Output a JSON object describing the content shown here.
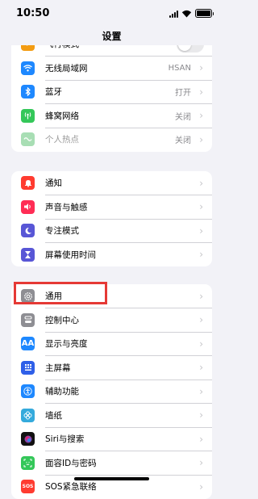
{
  "status": {
    "time": "10:50"
  },
  "nav": {
    "title": "设置"
  },
  "group1": {
    "items": [
      {
        "label": "飞行模式",
        "value": "",
        "icon": "airplane-icon",
        "color": "#F39C12"
      },
      {
        "label": "无线局域网",
        "value": "HSAN",
        "icon": "wifi-icon",
        "color": "#1E88FF"
      },
      {
        "label": "蓝牙",
        "value": "打开",
        "icon": "bluetooth-icon",
        "color": "#1E88FF"
      },
      {
        "label": "蜂窝网络",
        "value": "关闭",
        "icon": "cellular-icon",
        "color": "#34C759"
      },
      {
        "label": "个人热点",
        "value": "关闭",
        "icon": "hotspot-icon",
        "color": "#A8DEB4"
      }
    ]
  },
  "group2": {
    "items": [
      {
        "label": "通知",
        "icon": "notification-icon",
        "color": "#FF3B30"
      },
      {
        "label": "声音与触感",
        "icon": "sound-icon",
        "color": "#FF2D55"
      },
      {
        "label": "专注模式",
        "icon": "moon-icon",
        "color": "#5856D6"
      },
      {
        "label": "屏幕使用时间",
        "icon": "hourglass-icon",
        "color": "#5856D6"
      }
    ]
  },
  "group3": {
    "items": [
      {
        "label": "通用",
        "icon": "gear-icon",
        "color": "#8E8E93"
      },
      {
        "label": "控制中心",
        "icon": "control-center-icon",
        "color": "#8E8E93"
      },
      {
        "label": "显示与亮度",
        "icon": "display-icon",
        "color": "#1E88FF",
        "glyph": "AA"
      },
      {
        "label": "主屏幕",
        "icon": "home-screen-icon",
        "color": "#2F5FE8"
      },
      {
        "label": "辅助功能",
        "icon": "accessibility-icon",
        "color": "#1E88FF"
      },
      {
        "label": "墙纸",
        "icon": "wallpaper-icon",
        "color": "#34AADC"
      },
      {
        "label": "Siri与搜索",
        "icon": "siri-icon",
        "color": "#111111"
      },
      {
        "label": "面容ID与密码",
        "icon": "face-id-icon",
        "color": "#34C759"
      },
      {
        "label": "SOS紧急联络",
        "icon": "sos-icon",
        "color": "#FF3B30"
      }
    ]
  }
}
